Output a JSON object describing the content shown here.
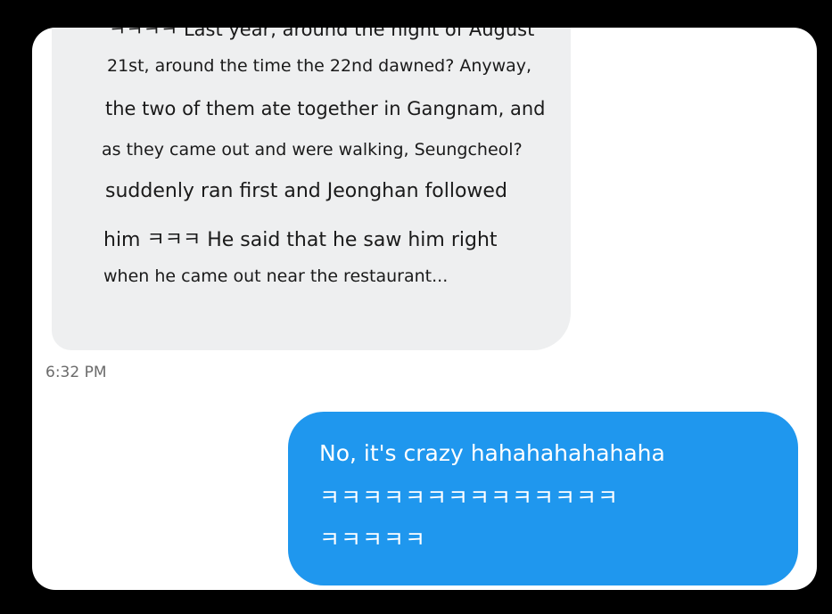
{
  "incoming_message": {
    "lines": [
      "ㅋㅋㅋㅋ Last year, around the night of August",
      "21st, around the time the 22nd dawned? Anyway,",
      "the two of them ate together in Gangnam, and",
      "as they came out and were walking, Seungcheol?",
      "suddenly ran first and Jeonghan followed",
      "him ㅋㅋㅋ He said that he saw him right",
      "when he came out near the restaurant..."
    ],
    "timestamp": "6:32 PM"
  },
  "outgoing_message": {
    "lines": [
      "No, it's crazy hahahahahahaha",
      "ㅋㅋㅋㅋㅋㅋㅋㅋㅋㅋㅋㅋㅋㅋ",
      "ㅋㅋㅋㅋㅋ"
    ]
  },
  "colors": {
    "background": "#000000",
    "card": "#ffffff",
    "incoming_bubble": "#eeeff0",
    "outgoing_bubble": "#1f97ee",
    "timestamp": "#6b6b6b"
  }
}
